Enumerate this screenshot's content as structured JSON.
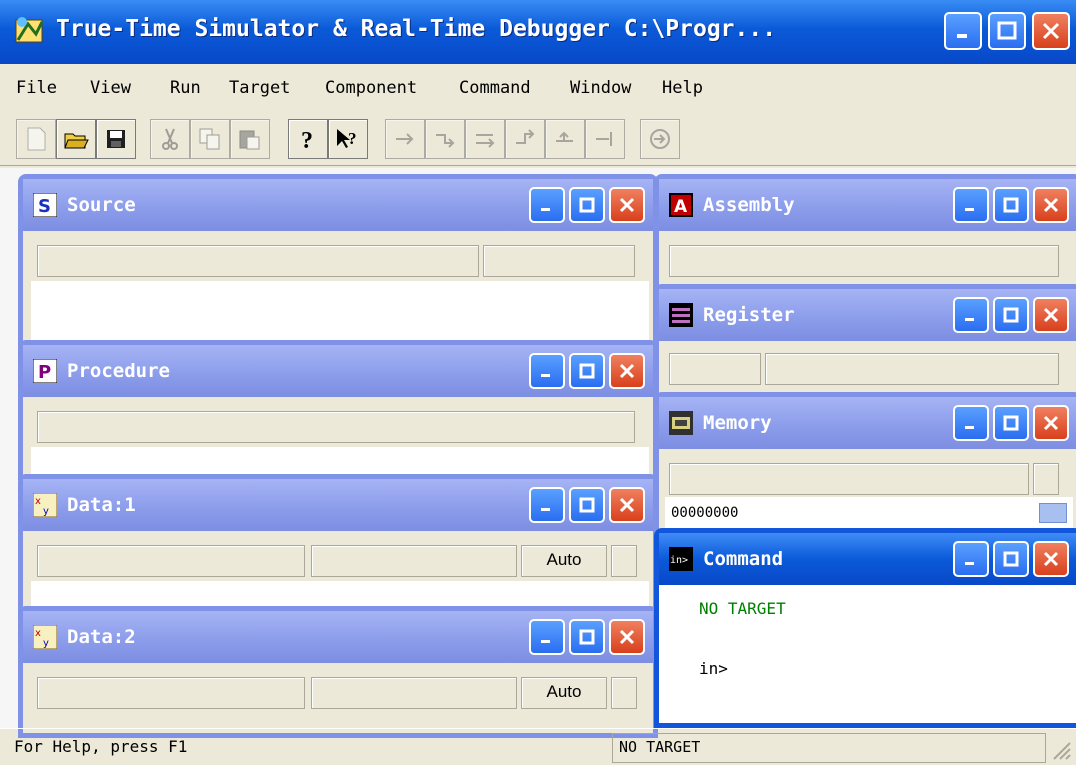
{
  "window": {
    "title": "True-Time Simulator & Real-Time Debugger   C:\\Progr..."
  },
  "menu": [
    "File",
    "View",
    "Run",
    "Target",
    "Component",
    "Command",
    "Window",
    "Help"
  ],
  "windows": {
    "source": {
      "title": "Source"
    },
    "procedure": {
      "title": "Procedure"
    },
    "data1": {
      "title": "Data:1",
      "mode": "Auto"
    },
    "data2": {
      "title": "Data:2",
      "mode": "Auto"
    },
    "assembly": {
      "title": "Assembly"
    },
    "register": {
      "title": "Register"
    },
    "memory": {
      "title": "Memory",
      "address": "00000000"
    },
    "command": {
      "title": "Command",
      "line1": "NO TARGET",
      "prompt": "in>"
    }
  },
  "status": {
    "help": "For Help, press F1",
    "target": "NO TARGET"
  },
  "colors": {
    "active_title": "#0b5ad9",
    "inactive_title": "#8a9bea",
    "no_target_text": "#008000"
  }
}
